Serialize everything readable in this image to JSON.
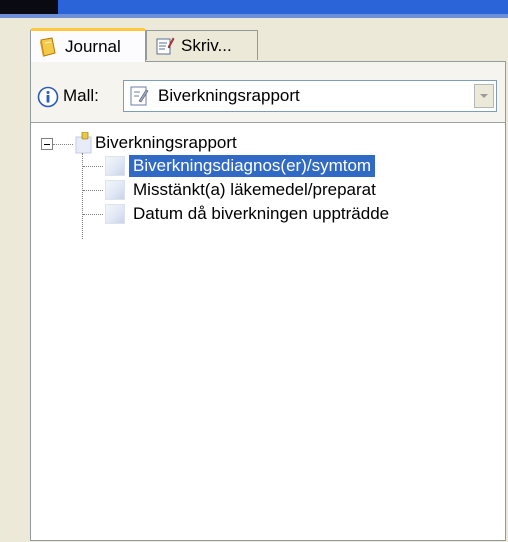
{
  "tabs": [
    {
      "label": "Journal",
      "icon": "journal-book-icon",
      "active": true
    },
    {
      "label": "Skriv...",
      "icon": "write-document-icon",
      "active": false
    }
  ],
  "mall": {
    "label": "Mall:",
    "selected": "Biverkningsrapport"
  },
  "tree": {
    "root": {
      "label": "Biverkningsrapport",
      "expanded": true
    },
    "children": [
      {
        "label": "Biverkningsdiagnos(er)/symtom",
        "selected": true
      },
      {
        "label": "Misstänkt(a) läkemedel/preparat",
        "selected": false
      },
      {
        "label": "Datum då biverkningen uppträdde",
        "selected": false
      }
    ]
  },
  "colors": {
    "selection": "#316ac5",
    "title_bar": "#2b63d8",
    "panel_border": "#919b9c"
  }
}
